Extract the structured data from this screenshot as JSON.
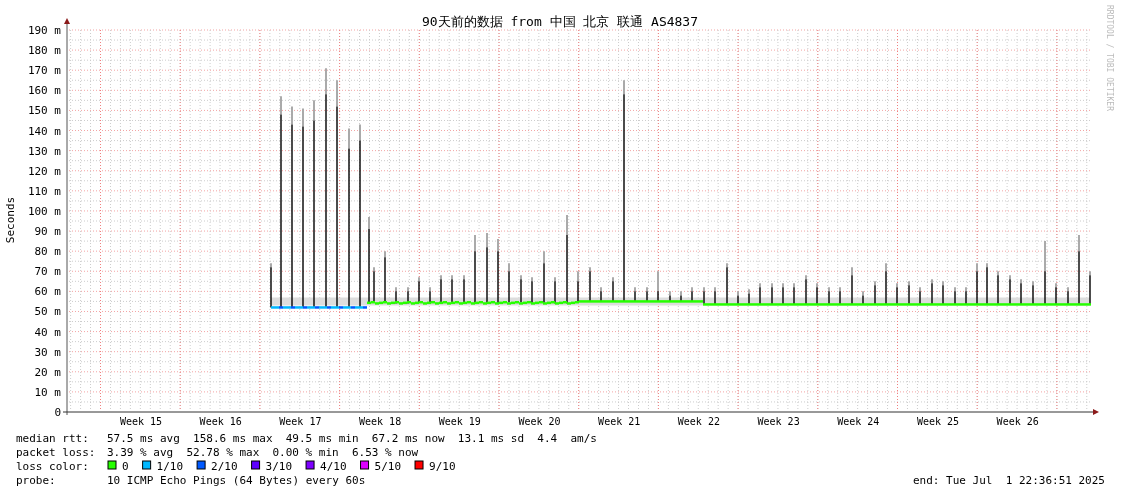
{
  "chart": {
    "title": "90天前的数据 from 中国 北京 联通 AS4837",
    "side_text": "RRDTOOL / TOBI OETIKER",
    "ylabel": "Seconds",
    "yticks": [
      "190 m",
      "180 m",
      "170 m",
      "160 m",
      "150 m",
      "140 m",
      "130 m",
      "120 m",
      "110 m",
      "100 m",
      "90 m",
      "80 m",
      "70 m",
      "60 m",
      "50 m",
      "40 m",
      "30 m",
      "20 m",
      "10 m",
      "0"
    ],
    "xticks": [
      "Week 15",
      "Week 16",
      "Week 17",
      "Week 18",
      "Week 19",
      "Week 20",
      "Week 21",
      "Week 22",
      "Week 23",
      "Week 24",
      "Week 25",
      "Week 26"
    ]
  },
  "legend": {
    "median_rtt": {
      "label": "median rtt:",
      "items": [
        "57.5 ms avg",
        "158.6 ms max",
        "49.5 ms min",
        "67.2 ms now",
        "13.1 ms sd",
        "4.4",
        "am/s"
      ]
    },
    "packet_loss": {
      "label": "packet loss:",
      "items": [
        "3.39 % avg",
        "52.78 % max",
        "0.00 % min",
        "6.53 % now"
      ]
    },
    "loss_color": {
      "label": "loss color:",
      "items": [
        {
          "label": "0",
          "color": "#26ff00"
        },
        {
          "label": "1/10",
          "color": "#00b8ff"
        },
        {
          "label": "2/10",
          "color": "#0059ff"
        },
        {
          "label": "3/10",
          "color": "#5e00ff"
        },
        {
          "label": "4/10",
          "color": "#7e00ff"
        },
        {
          "label": "5/10",
          "color": "#dd00ff"
        },
        {
          "label": "9/10",
          "color": "#ff0000"
        }
      ]
    },
    "probe": {
      "label": "probe:",
      "value": "10 ICMP Echo Pings (64 Bytes) every 60s"
    },
    "end": "end: Tue Jul  1 22:36:51 2025"
  }
}
